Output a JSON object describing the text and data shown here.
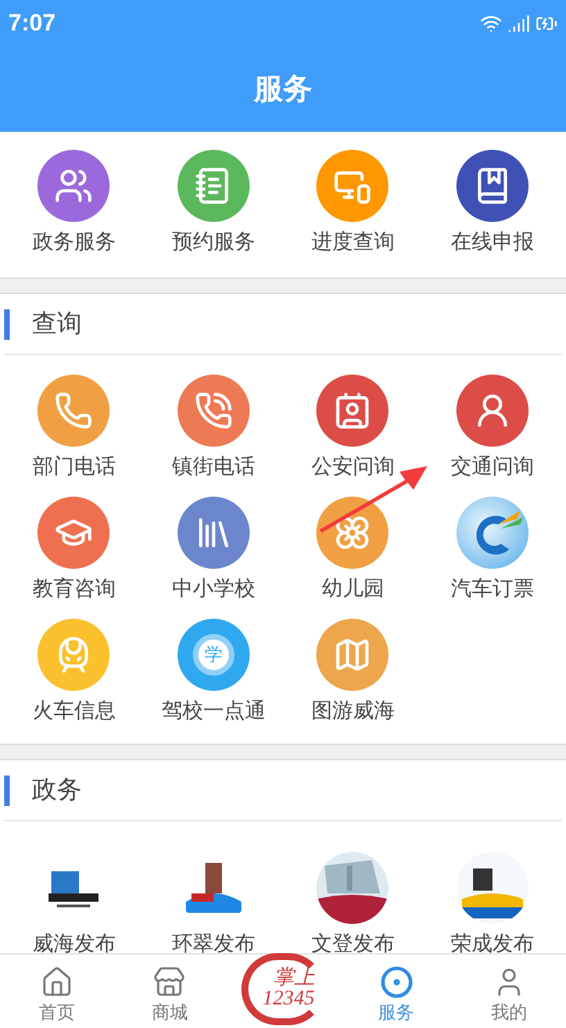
{
  "status_bar": {
    "time": "7:07"
  },
  "header": {
    "title": "服务"
  },
  "quick_services": [
    {
      "label": "政务服务",
      "color": "#9b69dc"
    },
    {
      "label": "预约服务",
      "color": "#5cb85c"
    },
    {
      "label": "进度查询",
      "color": "#ff9800"
    },
    {
      "label": "在线申报",
      "color": "#3f51b5"
    }
  ],
  "sections": [
    {
      "title": "查询",
      "items": [
        {
          "label": "部门电话",
          "kind": "icon"
        },
        {
          "label": "镇街电话",
          "kind": "icon"
        },
        {
          "label": "公安问询",
          "kind": "icon"
        },
        {
          "label": "交通问询",
          "kind": "icon"
        },
        {
          "label": "教育咨询",
          "kind": "icon"
        },
        {
          "label": "中小学校",
          "kind": "icon"
        },
        {
          "label": "幼儿园",
          "kind": "icon"
        },
        {
          "label": "汽车订票",
          "kind": "logo"
        },
        {
          "label": "火车信息",
          "kind": "icon"
        },
        {
          "label": "驾校一点通",
          "kind": "badge",
          "badge": "学"
        },
        {
          "label": "图游威海",
          "kind": "icon"
        }
      ]
    },
    {
      "title": "政务",
      "items": [
        {
          "label": "威海发布",
          "kind": "picture"
        },
        {
          "label": "环翠发布",
          "kind": "picture"
        },
        {
          "label": "文登发布",
          "kind": "picture"
        },
        {
          "label": "荣成发布",
          "kind": "picture"
        }
      ]
    }
  ],
  "tab_bar": {
    "items": [
      {
        "label": "首页",
        "kind": "tab",
        "selected": false
      },
      {
        "label": "商城",
        "kind": "tab",
        "selected": false
      },
      {
        "kind": "logo",
        "line1": "掌上",
        "line2": "12345"
      },
      {
        "label": "服务",
        "kind": "tab",
        "selected": true
      },
      {
        "label": "我的",
        "kind": "tab",
        "selected": false
      }
    ]
  }
}
